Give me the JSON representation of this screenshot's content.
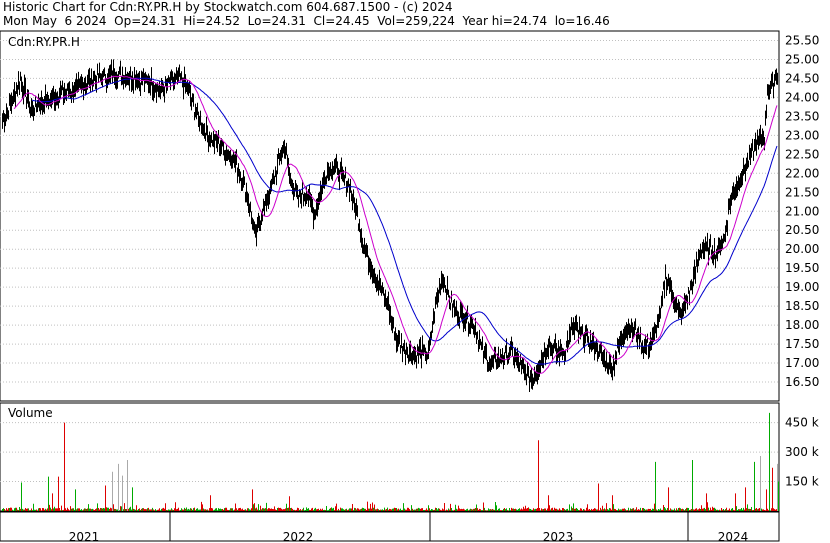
{
  "header": {
    "line1": "Historic Chart for Cdn:RY.PR.H by Stockwatch.com 604.687.1500 - (c) 2024",
    "line2": "Mon May  6 2024  Op=24.31  Hi=24.52  Lo=24.31  Cl=24.45  Vol=259,224  Year hi=24.74  lo=16.46"
  },
  "chart_data": [
    {
      "type": "line",
      "title": "Cdn:RY.PR.H",
      "yticks": [
        "16.50",
        "17.00",
        "17.50",
        "18.00",
        "18.50",
        "19.00",
        "19.50",
        "20.00",
        "20.50",
        "21.00",
        "21.50",
        "22.00",
        "22.50",
        "23.00",
        "23.50",
        "24.00",
        "24.50",
        "25.00",
        "25.50"
      ],
      "ylim": [
        16.0,
        25.75
      ],
      "grid": true,
      "x_labels": [
        "2021",
        "2022",
        "2023",
        "2024"
      ],
      "price_anchors": [
        [
          0,
          23.3
        ],
        [
          10,
          23.8
        ],
        [
          20,
          24.5
        ],
        [
          30,
          23.7
        ],
        [
          45,
          23.9
        ],
        [
          60,
          24.1
        ],
        [
          75,
          24.2
        ],
        [
          95,
          24.5
        ],
        [
          115,
          24.6
        ],
        [
          135,
          24.5
        ],
        [
          150,
          24.4
        ],
        [
          160,
          24.2
        ],
        [
          170,
          24.4
        ],
        [
          180,
          24.5
        ],
        [
          188,
          24.2
        ],
        [
          195,
          23.6
        ],
        [
          205,
          23.1
        ],
        [
          215,
          22.8
        ],
        [
          225,
          22.6
        ],
        [
          235,
          22.3
        ],
        [
          243,
          21.8
        ],
        [
          250,
          21.0
        ],
        [
          255,
          20.3
        ],
        [
          262,
          21.0
        ],
        [
          270,
          21.5
        ],
        [
          278,
          22.3
        ],
        [
          284,
          22.8
        ],
        [
          290,
          21.8
        ],
        [
          298,
          21.3
        ],
        [
          306,
          21.5
        ],
        [
          314,
          20.9
        ],
        [
          320,
          21.5
        ],
        [
          326,
          22.0
        ],
        [
          332,
          22.2
        ],
        [
          340,
          22.0
        ],
        [
          348,
          21.7
        ],
        [
          356,
          21.0
        ],
        [
          364,
          20.0
        ],
        [
          372,
          19.5
        ],
        [
          380,
          19.0
        ],
        [
          388,
          18.5
        ],
        [
          396,
          17.6
        ],
        [
          404,
          17.4
        ],
        [
          412,
          17.2
        ],
        [
          420,
          17.3
        ],
        [
          428,
          17.2
        ],
        [
          435,
          18.5
        ],
        [
          442,
          19.3
        ],
        [
          450,
          18.6
        ],
        [
          458,
          18.3
        ],
        [
          466,
          18.2
        ],
        [
          474,
          18.0
        ],
        [
          482,
          17.3
        ],
        [
          490,
          17.0
        ],
        [
          500,
          17.1
        ],
        [
          510,
          17.3
        ],
        [
          518,
          17.0
        ],
        [
          525,
          16.7
        ],
        [
          532,
          16.6
        ],
        [
          540,
          17.0
        ],
        [
          548,
          17.5
        ],
        [
          556,
          17.3
        ],
        [
          564,
          17.3
        ],
        [
          572,
          17.9
        ],
        [
          580,
          17.8
        ],
        [
          588,
          17.6
        ],
        [
          596,
          17.4
        ],
        [
          604,
          17.1
        ],
        [
          612,
          16.9
        ],
        [
          620,
          17.6
        ],
        [
          628,
          18.0
        ],
        [
          636,
          17.8
        ],
        [
          644,
          17.4
        ],
        [
          652,
          17.6
        ],
        [
          660,
          18.3
        ],
        [
          665,
          19.3
        ],
        [
          672,
          18.8
        ],
        [
          680,
          18.2
        ],
        [
          688,
          18.8
        ],
        [
          694,
          19.3
        ],
        [
          700,
          20.0
        ],
        [
          708,
          20.0
        ],
        [
          716,
          19.9
        ],
        [
          724,
          20.3
        ],
        [
          730,
          21.3
        ],
        [
          738,
          21.8
        ],
        [
          746,
          22.2
        ],
        [
          754,
          22.7
        ],
        [
          760,
          22.9
        ],
        [
          764,
          23.0
        ],
        [
          767,
          24.2
        ],
        [
          772,
          24.4
        ],
        [
          777,
          24.6
        ]
      ],
      "series": [
        {
          "color": "#000000",
          "label": ""
        },
        {
          "color": "#cc00cc",
          "label": ""
        },
        {
          "color": "#0000cc",
          "label": ""
        }
      ]
    },
    {
      "type": "bar",
      "title": "Volume",
      "yticks": [
        "150 k",
        "300 k",
        "450 k"
      ],
      "ylim": [
        0,
        550
      ],
      "colors": {
        "up": "#00aa00",
        "down": "#dd0000",
        "neutral": "#aaaaaa"
      },
      "highlight_bars": [
        [
          64,
          450,
          "down"
        ],
        [
          21,
          145,
          "up"
        ],
        [
          48,
          175,
          "up"
        ],
        [
          52,
          90,
          "down"
        ],
        [
          58,
          175,
          "down"
        ],
        [
          75,
          110,
          "up"
        ],
        [
          105,
          130,
          "down"
        ],
        [
          112,
          200,
          "neutral"
        ],
        [
          118,
          240,
          "neutral"
        ],
        [
          122,
          180,
          "neutral"
        ],
        [
          127,
          260,
          "neutral"
        ],
        [
          132,
          120,
          "up"
        ],
        [
          210,
          80,
          "down"
        ],
        [
          252,
          110,
          "down"
        ],
        [
          289,
          75,
          "down"
        ],
        [
          538,
          360,
          "down"
        ],
        [
          548,
          80,
          "down"
        ],
        [
          598,
          140,
          "down"
        ],
        [
          612,
          80,
          "down"
        ],
        [
          655,
          250,
          "up"
        ],
        [
          668,
          120,
          "down"
        ],
        [
          692,
          260,
          "up"
        ],
        [
          706,
          90,
          "down"
        ],
        [
          735,
          90,
          "down"
        ],
        [
          745,
          120,
          "down"
        ],
        [
          754,
          250,
          "up"
        ],
        [
          760,
          280,
          "neutral"
        ],
        [
          766,
          110,
          "down"
        ],
        [
          769,
          500,
          "up"
        ],
        [
          772,
          220,
          "down"
        ],
        [
          777,
          240,
          "neutral"
        ],
        [
          778,
          150,
          "up"
        ]
      ]
    }
  ]
}
